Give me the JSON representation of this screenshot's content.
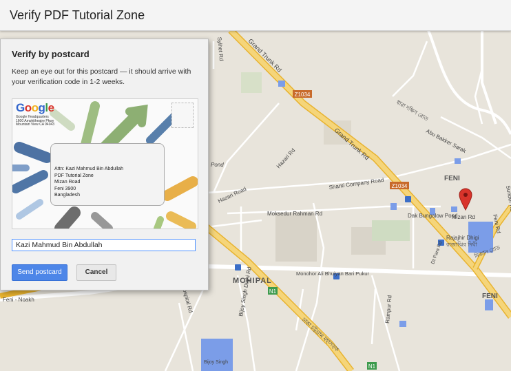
{
  "window": {
    "title": "Verify PDF Tutorial Zone"
  },
  "dialog": {
    "title": "Verify by postcard",
    "description": "Keep an eye out for this postcard — it should arrive with your verification code in 1-2 weeks.",
    "postcard": {
      "logo": "Google",
      "hq_lines": [
        "Google Headquarters",
        "1600 Amphitheatre Pkwy",
        "Mountain View CA 94043"
      ],
      "address_lines": [
        "Attn: Kazi Mahmud Bin Abdullah",
        "PDF Tutorial Zone",
        "Mizan Road",
        "Feni 3900",
        "Bangladesh"
      ]
    },
    "name_input": {
      "value": "Kazi Mahmud Bin Abdullah"
    },
    "send_label": "Send postcard",
    "cancel_label": "Cancel"
  },
  "map": {
    "labels": {
      "grand_trunk_rd_1": "Grand Trunk Rd",
      "grand_trunk_rd_2": "Grand Trunk Rd",
      "route_z1034_1": "Z1034",
      "route_z1034_2": "Z1034",
      "hazari_rd": "Hazari Rd",
      "hazari_road": "Hazari Road",
      "pond": "Pond",
      "shanti_company": "Shanti Company Road",
      "moksedur": "Moksedur Rahman Rd",
      "abu_bakker": "Abu Bakker Sarak",
      "feni_upper": "FENI",
      "feni_lower": "FENI",
      "dak_bungalow": "Dak Bungalow Pond",
      "mizan_rd": "Mizan Rd",
      "feni_rd": "Feni Rd",
      "rajajhir": "Rajajhir Dhigi",
      "rajajhir_bn": "রাজাঝির দিঘী",
      "dt_para": "Dt Para Rd",
      "monohor": "Monohor Ali Bhuiyan Bari Pukur",
      "mohipal": "MOHIPAL",
      "route_n1_1": "N1",
      "route_n1_2": "N1",
      "bijoy": "Bijoy Singh Dighi Rd",
      "rampur": "Rampur Rd",
      "feni_noakhali": "Feni - Noakh",
      "sylhet": "Sylhet Rd",
      "hospital": "Hospital Rd",
      "sunder": "Sunder Rd",
      "bn_dhaka": "ঢাকা চট্টগ্রাম মহাসড়ক",
      "bn_top": "ধারা দক্ষিণ রোড",
      "bn_mid": "মিজান রোড",
      "bijoy_bottom": "Bijoy Singh"
    }
  }
}
